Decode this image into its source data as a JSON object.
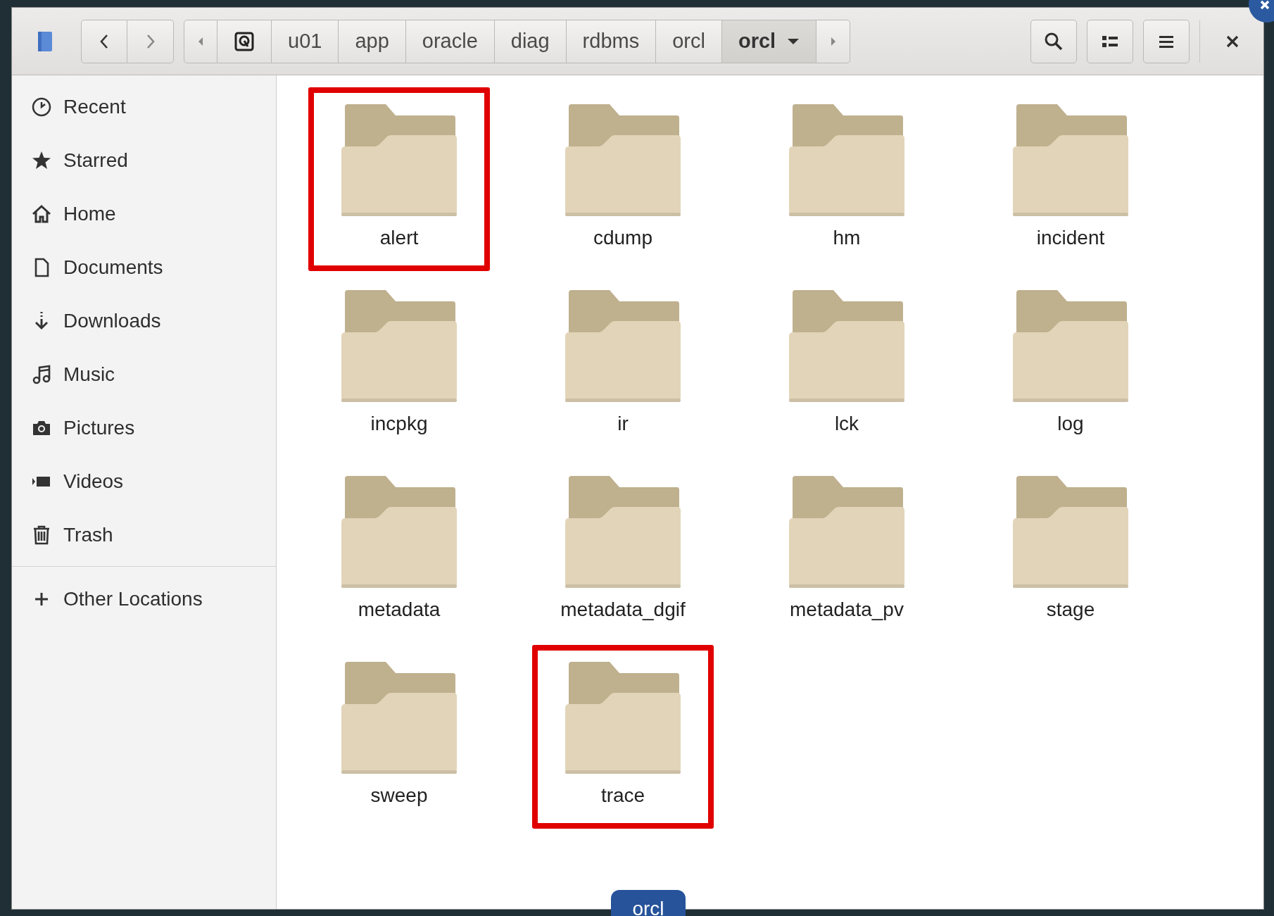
{
  "header": {
    "path": [
      {
        "label": "u01",
        "selected": false
      },
      {
        "label": "app",
        "selected": false
      },
      {
        "label": "oracle",
        "selected": false
      },
      {
        "label": "diag",
        "selected": false
      },
      {
        "label": "rdbms",
        "selected": false
      },
      {
        "label": "orcl",
        "selected": false
      },
      {
        "label": "orcl",
        "selected": true
      }
    ]
  },
  "sidebar": {
    "places": [
      {
        "label": "Recent",
        "kind": "recent"
      },
      {
        "label": "Starred",
        "kind": "starred"
      },
      {
        "label": "Home",
        "kind": "home"
      },
      {
        "label": "Documents",
        "kind": "documents"
      },
      {
        "label": "Downloads",
        "kind": "downloads"
      },
      {
        "label": "Music",
        "kind": "music"
      },
      {
        "label": "Pictures",
        "kind": "pictures"
      },
      {
        "label": "Videos",
        "kind": "videos"
      },
      {
        "label": "Trash",
        "kind": "trash"
      }
    ],
    "other": {
      "label": "Other Locations"
    }
  },
  "folders": [
    {
      "name": "alert",
      "highlighted": true
    },
    {
      "name": "cdump",
      "highlighted": false
    },
    {
      "name": "hm",
      "highlighted": false
    },
    {
      "name": "incident",
      "highlighted": false
    },
    {
      "name": "incpkg",
      "highlighted": false
    },
    {
      "name": "ir",
      "highlighted": false
    },
    {
      "name": "lck",
      "highlighted": false
    },
    {
      "name": "log",
      "highlighted": false
    },
    {
      "name": "metadata",
      "highlighted": false
    },
    {
      "name": "metadata_dgif",
      "highlighted": false
    },
    {
      "name": "metadata_pv",
      "highlighted": false
    },
    {
      "name": "stage",
      "highlighted": false
    },
    {
      "name": "sweep",
      "highlighted": false
    },
    {
      "name": "trace",
      "highlighted": true
    }
  ],
  "tooltip": {
    "label": "orcl"
  }
}
